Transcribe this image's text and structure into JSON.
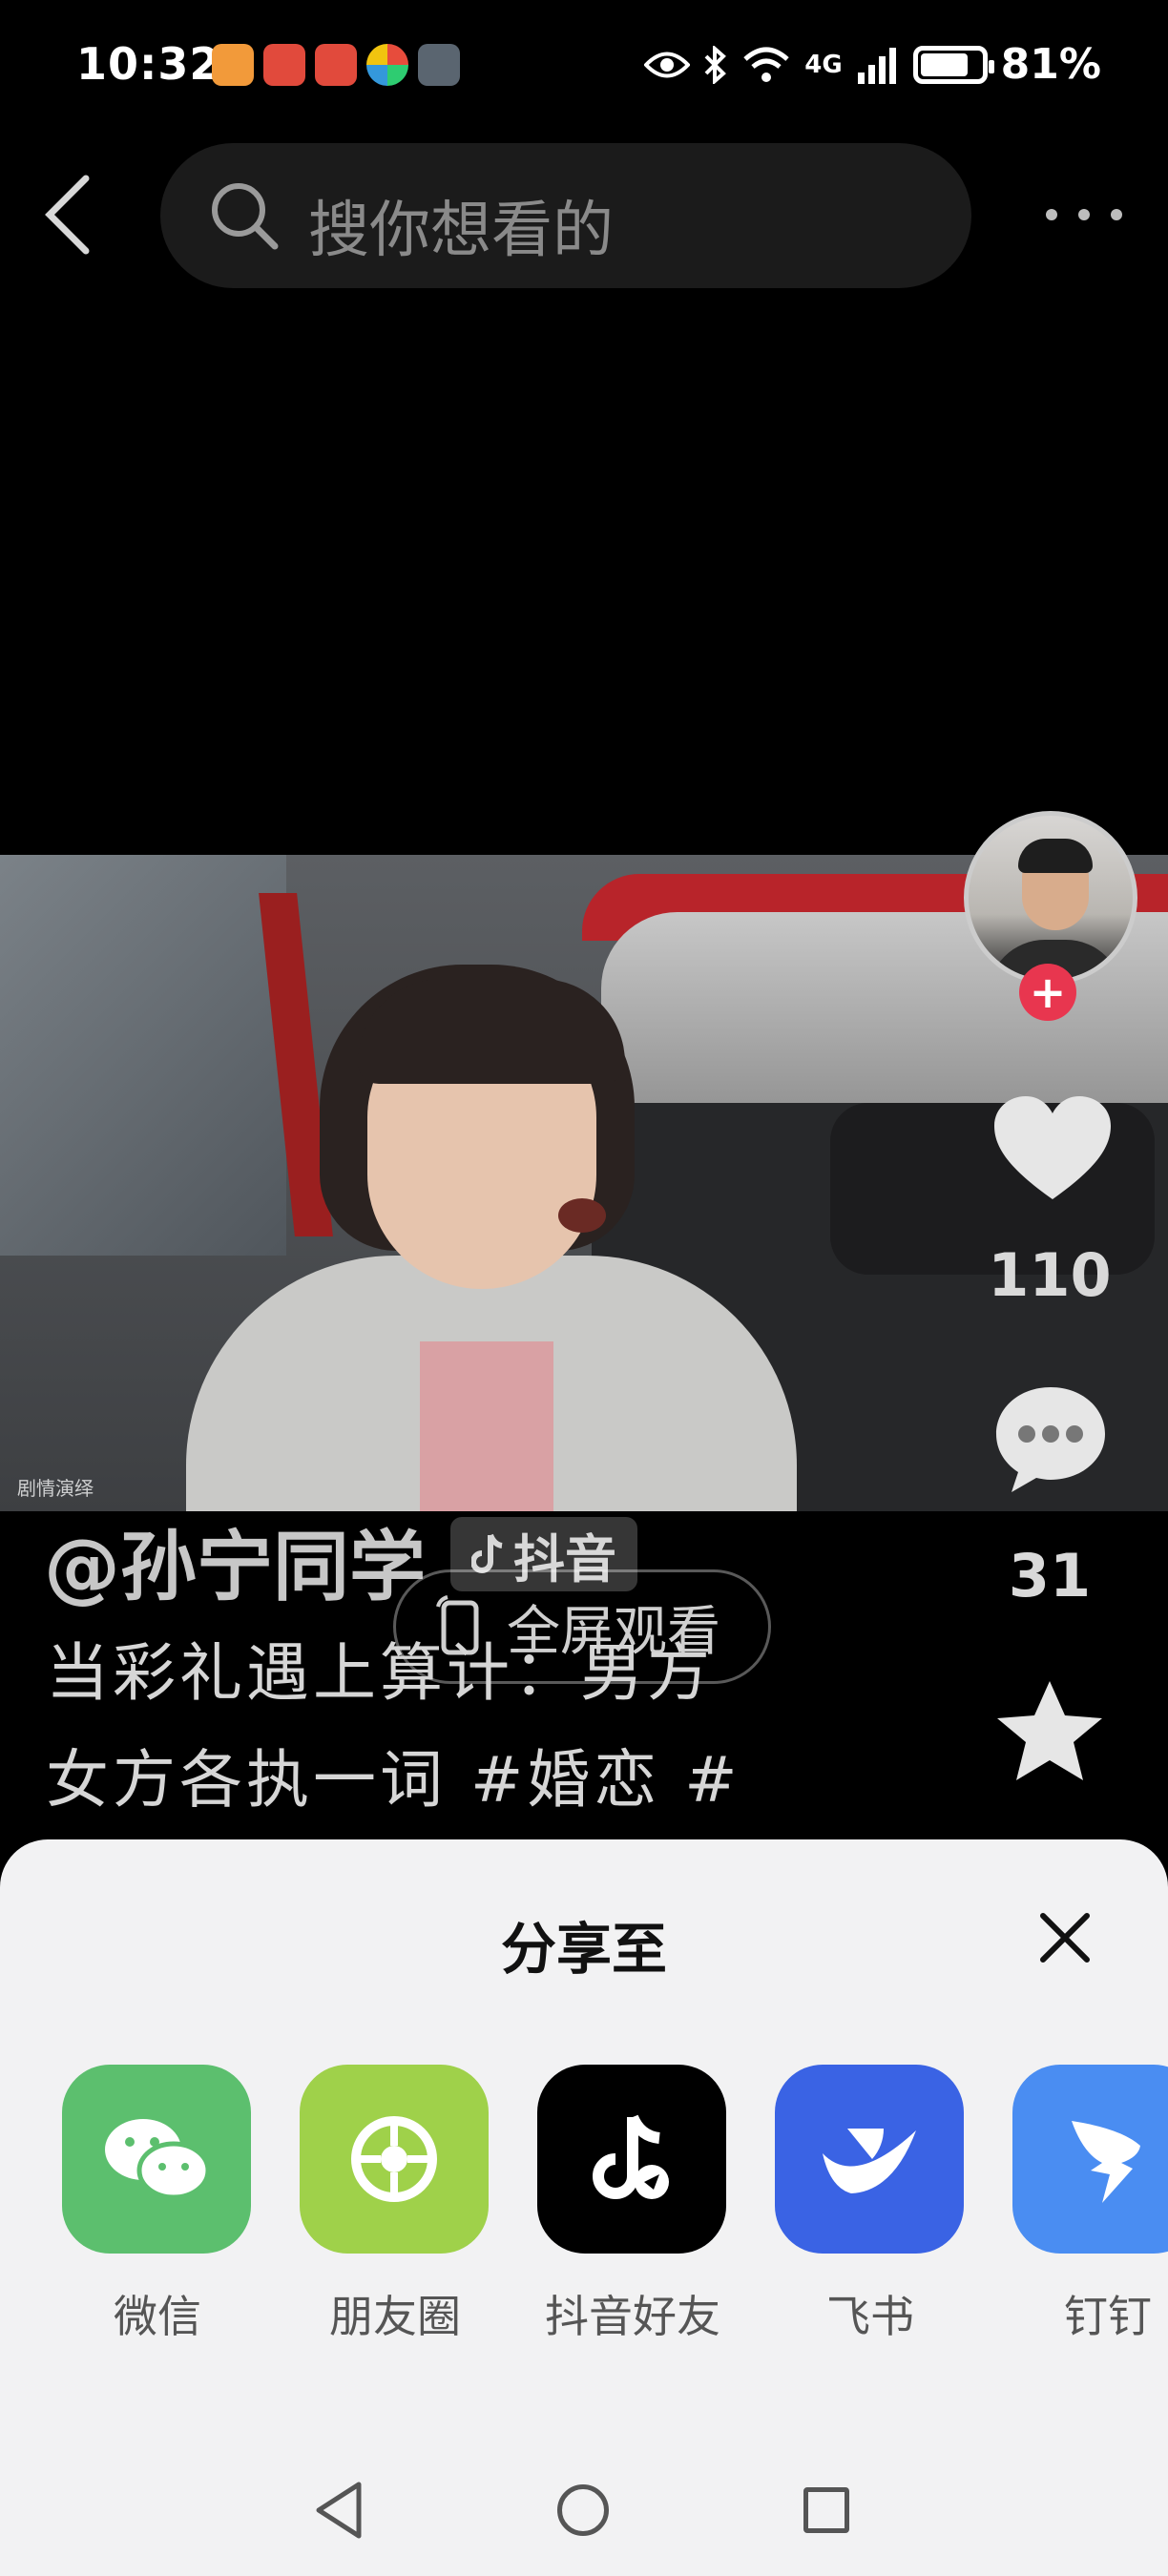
{
  "status_bar": {
    "time": "10:32",
    "network": "4G",
    "battery": "81%",
    "battery_level": 0.81
  },
  "header": {
    "search_placeholder": "搜你想看的",
    "back_icon": "chevron-left-icon",
    "more_icon": "more-dots-icon"
  },
  "video": {
    "watermark": "剧情演绎",
    "author": "@孙宁同学",
    "platform_tag": "抖音",
    "fullscreen_label": "全屏观看",
    "description_line1": "当彩礼遇上算计：男方",
    "description_line2": "女方各执一词 #婚恋 #"
  },
  "actions": {
    "likes": "110",
    "comments": "31"
  },
  "share_sheet": {
    "title": "分享至",
    "targets": [
      {
        "label": "微信",
        "color": "#5cbf6e",
        "icon": "wechat-icon"
      },
      {
        "label": "朋友圈",
        "color": "#9fd14a",
        "icon": "moments-icon"
      },
      {
        "label": "抖音好友",
        "color": "#000000",
        "icon": "douyin-icon"
      },
      {
        "label": "飞书",
        "color": "#3a63e4",
        "icon": "feishu-icon"
      },
      {
        "label": "钉钉",
        "color": "#4a8df2",
        "icon": "dingtalk-icon"
      }
    ]
  },
  "colors": {
    "background": "#000000",
    "accent_red": "#e8364f",
    "sheet_bg": "#f2f2f3"
  }
}
